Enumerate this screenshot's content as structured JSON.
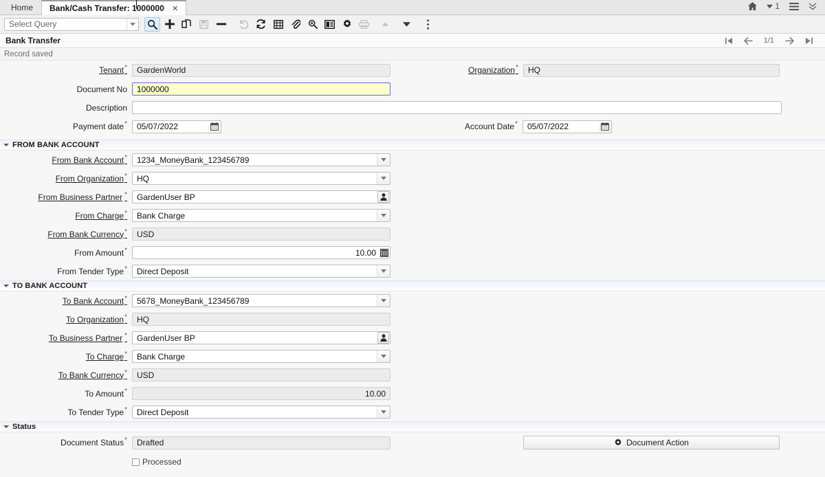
{
  "window": {
    "tabs": [
      {
        "label": "Home",
        "active": false,
        "closable": false
      },
      {
        "label": "Bank/Cash Transfer: 1000000",
        "active": true,
        "closable": true,
        "close_glyph": "✕"
      }
    ],
    "right_icons": [
      {
        "name": "home-icon",
        "glyph": "home"
      },
      {
        "name": "notifications-count",
        "glyph": "caret-down",
        "count": "1"
      },
      {
        "name": "menu-icon",
        "glyph": "hamburger"
      },
      {
        "name": "collapse-icon",
        "glyph": "chevron-double-down"
      }
    ]
  },
  "toolbar": {
    "query_placeholder": "Select Query",
    "buttons": [
      {
        "name": "find-button",
        "icon": "search-icon",
        "selected": true,
        "disabled": false
      },
      {
        "name": "new-record-button",
        "icon": "plus-icon",
        "selected": false,
        "disabled": false
      },
      {
        "name": "copy-record-button",
        "icon": "copy-icon",
        "selected": false,
        "disabled": false
      },
      {
        "name": "save-button",
        "icon": "save-icon",
        "selected": false,
        "disabled": true
      },
      {
        "name": "delete-record-button",
        "icon": "minus-icon",
        "selected": false,
        "disabled": false
      },
      {
        "name": "undo-button",
        "icon": "undo-icon",
        "selected": false,
        "disabled": true
      },
      {
        "name": "refresh-button",
        "icon": "refresh-icon",
        "selected": false,
        "disabled": false
      },
      {
        "name": "grid-toggle-button",
        "icon": "grid-icon",
        "selected": false,
        "disabled": false
      },
      {
        "name": "attachment-button",
        "icon": "paperclip-icon",
        "selected": false,
        "disabled": false
      },
      {
        "name": "zoom-button",
        "icon": "zoom-icon",
        "selected": false,
        "disabled": false
      },
      {
        "name": "record-info-button",
        "icon": "record-info-icon",
        "selected": false,
        "disabled": false
      },
      {
        "name": "preferences-button",
        "icon": "gear-icon",
        "selected": false,
        "disabled": false
      },
      {
        "name": "print-button",
        "icon": "print-icon",
        "selected": false,
        "disabled": true
      },
      {
        "name": "scroll-up-button",
        "icon": "caret-up-icon",
        "selected": false,
        "disabled": true
      },
      {
        "name": "scroll-down-button",
        "icon": "caret-down-icon",
        "selected": false,
        "disabled": false
      },
      {
        "name": "more-menu-button",
        "icon": "kebab-menu-icon",
        "selected": false,
        "disabled": false
      }
    ]
  },
  "form": {
    "title": "Bank Transfer",
    "status_message": "Record saved",
    "pager": {
      "first_label": "first-record",
      "prev_label": "previous-record",
      "position": "1/1",
      "next_label": "next-record",
      "last_label": "last-record"
    }
  },
  "header_fields": {
    "tenant": {
      "label": "Tenant",
      "value": "GardenWorld",
      "required": true,
      "readonly": true,
      "link": true
    },
    "organization": {
      "label": "Organization",
      "value": "HQ",
      "required": true,
      "readonly": true,
      "link": true
    },
    "document_no": {
      "label": "Document No",
      "value": "1000000",
      "required": false,
      "readonly": false,
      "focused": true
    },
    "description": {
      "label": "Description",
      "value": "",
      "required": false,
      "readonly": false
    },
    "payment_date": {
      "label": "Payment date",
      "value": "05/07/2022",
      "required": true,
      "readonly": false
    },
    "account_date": {
      "label": "Account Date",
      "value": "05/07/2022",
      "required": true,
      "readonly": false
    }
  },
  "sections": {
    "from_bank_account": {
      "title": "FROM BANK ACCOUNT",
      "expanded": true,
      "fields": [
        {
          "name": "from-bank-account",
          "label": "From Bank Account",
          "value": "1234_MoneyBank_123456789",
          "required": true,
          "link": true,
          "widget": "dropdown",
          "readonly": false
        },
        {
          "name": "from-organization",
          "label": "From Organization",
          "value": "HQ",
          "required": true,
          "link": true,
          "widget": "dropdown",
          "readonly": false
        },
        {
          "name": "from-business-partner",
          "label": "From Business Partner",
          "value": "GardenUser BP",
          "required": true,
          "link": true,
          "spaced_star": true,
          "widget": "lookup",
          "readonly": false
        },
        {
          "name": "from-charge",
          "label": "From Charge",
          "value": "Bank Charge",
          "required": true,
          "link": true,
          "widget": "dropdown",
          "readonly": false
        },
        {
          "name": "from-bank-currency",
          "label": "From Bank Currency",
          "value": "USD",
          "required": true,
          "link": true,
          "widget": "plain",
          "readonly": true
        },
        {
          "name": "from-amount",
          "label": "From Amount",
          "value": "10.00",
          "required": true,
          "link": false,
          "widget": "amount",
          "readonly": false
        },
        {
          "name": "from-tender-type",
          "label": "From Tender Type",
          "value": "Direct Deposit",
          "required": true,
          "link": false,
          "widget": "dropdown",
          "readonly": false
        }
      ]
    },
    "to_bank_account": {
      "title": "TO BANK ACCOUNT",
      "expanded": true,
      "fields": [
        {
          "name": "to-bank-account",
          "label": "To Bank Account",
          "value": "5678_MoneyBank_123456789",
          "required": true,
          "link": true,
          "widget": "dropdown",
          "readonly": false
        },
        {
          "name": "to-organization",
          "label": "To Organization",
          "value": "HQ",
          "required": true,
          "link": true,
          "widget": "plain",
          "readonly": true
        },
        {
          "name": "to-business-partner",
          "label": "To Business Partner",
          "value": "GardenUser BP",
          "required": true,
          "link": true,
          "spaced_star": true,
          "widget": "lookup",
          "readonly": false
        },
        {
          "name": "to-charge",
          "label": "To Charge",
          "value": "Bank Charge",
          "required": true,
          "link": true,
          "widget": "dropdown",
          "readonly": false
        },
        {
          "name": "to-bank-currency",
          "label": "To Bank Currency",
          "value": "USD",
          "required": true,
          "link": true,
          "widget": "plain",
          "readonly": true
        },
        {
          "name": "to-amount",
          "label": "To Amount",
          "value": "10.00",
          "required": true,
          "link": false,
          "widget": "amount-ro",
          "readonly": true
        },
        {
          "name": "to-tender-type",
          "label": "To Tender Type",
          "value": "Direct Deposit",
          "required": true,
          "link": false,
          "widget": "dropdown",
          "readonly": false
        }
      ]
    },
    "status": {
      "title": "Status",
      "expanded": true,
      "document_status": {
        "label": "Document Status",
        "value": "Drafted",
        "required": true,
        "readonly": true
      },
      "document_action_button": {
        "label": "Document Action",
        "icon": "gear-icon"
      },
      "processed": {
        "label": "Processed",
        "checked": false
      }
    }
  },
  "colors": {
    "focus_field_bg": "#ffffcc",
    "focus_field_border": "#6a6ad0",
    "readonly_field_bg": "#ececec",
    "required_star": "#3b5fa8",
    "section_header_bg": "#eef2f9",
    "toolbar_selected_bg": "#dcecf8"
  }
}
